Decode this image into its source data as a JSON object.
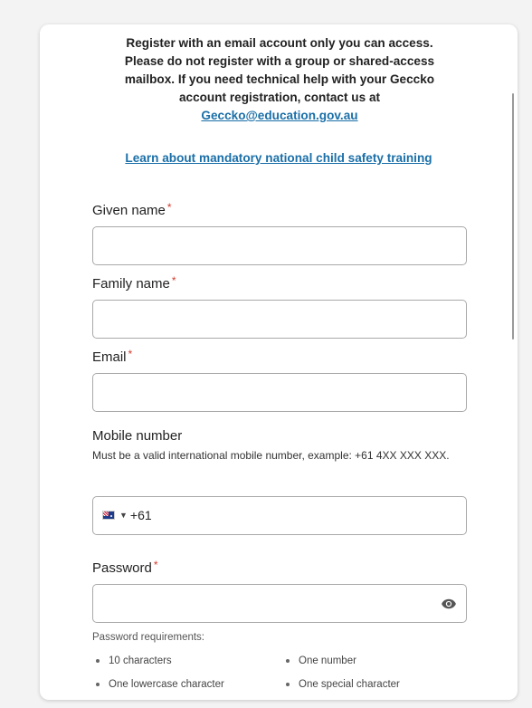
{
  "intro": {
    "line1": "Register with an email account only you can access.",
    "line2": "Please do not register with a group or shared-access",
    "line3": "mailbox. If you need technical help with your Geccko",
    "line4": "account registration, contact us at",
    "contact_email": "Geccko@education.gov.au"
  },
  "training_link": "Learn about mandatory national child safety training",
  "fields": {
    "given_name": {
      "label": "Given name",
      "required_mark": "*",
      "value": ""
    },
    "family_name": {
      "label": "Family name",
      "required_mark": "*",
      "value": ""
    },
    "email": {
      "label": "Email",
      "required_mark": "*",
      "value": ""
    },
    "mobile": {
      "label": "Mobile number",
      "help": "Must be a valid international mobile number, example: +61 4XX XXX XXX.",
      "country_code": "+61",
      "country_flag": "australia-flag-icon",
      "value": ""
    },
    "password": {
      "label": "Password",
      "required_mark": "*",
      "value": "",
      "toggle_icon": "eye-icon"
    }
  },
  "password_requirements": {
    "title": "Password requirements:",
    "items": [
      "10 characters",
      "One number",
      "One lowercase character",
      "One special character"
    ]
  },
  "colors": {
    "link": "#1a6fa8",
    "required": "#d33a2c",
    "border": "#a9a9a9"
  }
}
